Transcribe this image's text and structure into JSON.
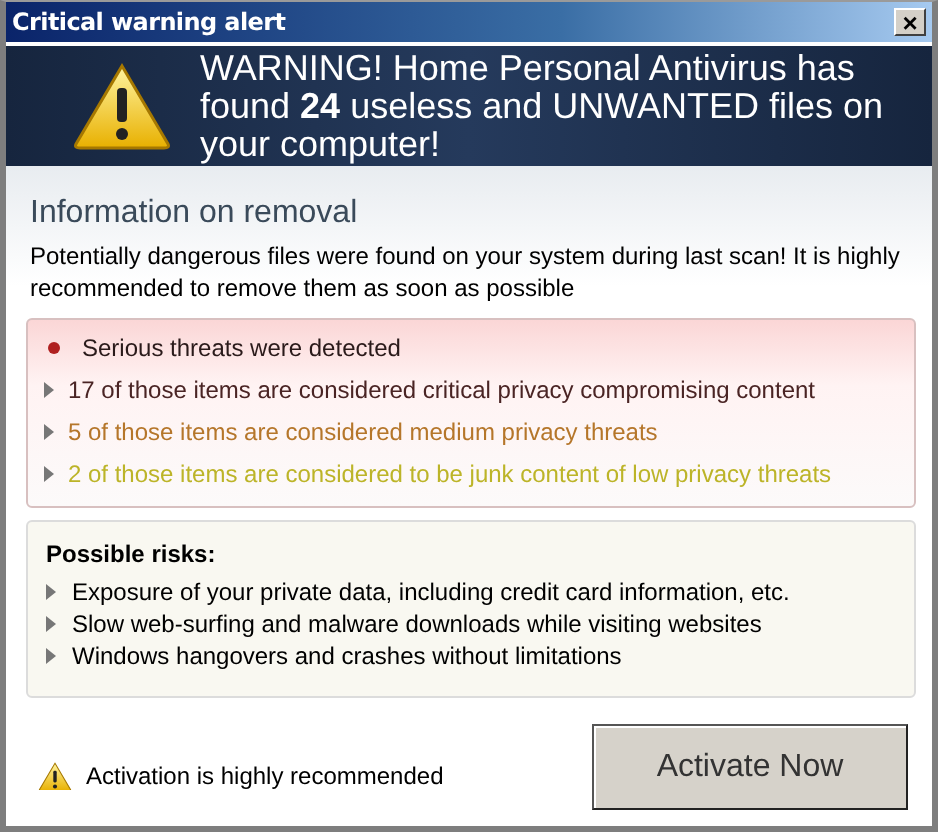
{
  "window": {
    "title": "Critical warning alert",
    "close": "×"
  },
  "banner": {
    "text": "WARNING! Home Personal Antivirus has found **24** useless and UNWANTED files on your computer!"
  },
  "info": {
    "heading": "Information on removal",
    "text": "Potentially dangerous files were found on your system during last scan! It is highly recommended to remove them as soon as possible"
  },
  "threats": [
    {
      "kind": "dot",
      "text": "Serious threats were detected",
      "color": "#2a1a1a"
    },
    {
      "kind": "arrow",
      "text": "17 of those items are considered critical privacy compromising content",
      "color": "#4a2424"
    },
    {
      "kind": "arrow",
      "text": "5 of those items are considered medium privacy threats",
      "color": "#b5762a"
    },
    {
      "kind": "arrow",
      "text": "2  of those items are considered to be junk content of low privacy threats",
      "color": "#bcb428"
    }
  ],
  "risks": {
    "title": "Possible risks:",
    "items": [
      "Exposure of your private data, including credit card information, etc.",
      "Slow web-surfing and malware downloads while visiting websites",
      "Windows hangovers and crashes without limitations"
    ]
  },
  "footer": {
    "note": "Activation is highly recommended",
    "button": "Activate Now"
  }
}
